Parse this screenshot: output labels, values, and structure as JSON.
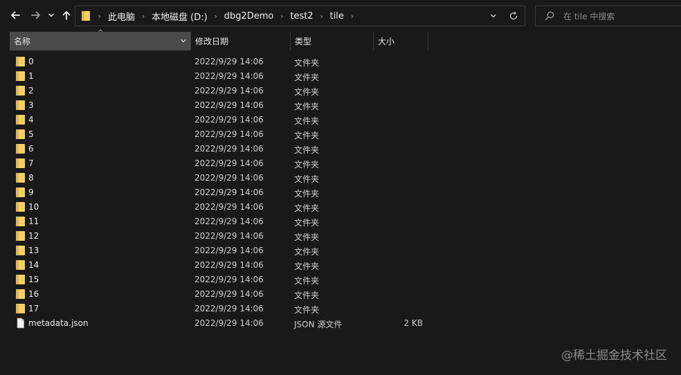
{
  "nav": {
    "back": "back-arrow",
    "forward": "forward-arrow",
    "recent": "chevron-down",
    "up": "up-arrow"
  },
  "address": {
    "crumbs": [
      "此电脑",
      "本地磁盘 (D:)",
      "dbg2Demo",
      "test2",
      "tile"
    ]
  },
  "search": {
    "placeholder": "在 tile 中搜索"
  },
  "columns": {
    "name": "名称",
    "date": "修改日期",
    "type": "类型",
    "size": "大小"
  },
  "files": [
    {
      "name": "0",
      "date": "2022/9/29 14:06",
      "type": "文件夹",
      "size": "",
      "kind": "folder"
    },
    {
      "name": "1",
      "date": "2022/9/29 14:06",
      "type": "文件夹",
      "size": "",
      "kind": "folder"
    },
    {
      "name": "2",
      "date": "2022/9/29 14:06",
      "type": "文件夹",
      "size": "",
      "kind": "folder"
    },
    {
      "name": "3",
      "date": "2022/9/29 14:06",
      "type": "文件夹",
      "size": "",
      "kind": "folder"
    },
    {
      "name": "4",
      "date": "2022/9/29 14:06",
      "type": "文件夹",
      "size": "",
      "kind": "folder"
    },
    {
      "name": "5",
      "date": "2022/9/29 14:06",
      "type": "文件夹",
      "size": "",
      "kind": "folder"
    },
    {
      "name": "6",
      "date": "2022/9/29 14:06",
      "type": "文件夹",
      "size": "",
      "kind": "folder"
    },
    {
      "name": "7",
      "date": "2022/9/29 14:06",
      "type": "文件夹",
      "size": "",
      "kind": "folder"
    },
    {
      "name": "8",
      "date": "2022/9/29 14:06",
      "type": "文件夹",
      "size": "",
      "kind": "folder"
    },
    {
      "name": "9",
      "date": "2022/9/29 14:06",
      "type": "文件夹",
      "size": "",
      "kind": "folder"
    },
    {
      "name": "10",
      "date": "2022/9/29 14:06",
      "type": "文件夹",
      "size": "",
      "kind": "folder"
    },
    {
      "name": "11",
      "date": "2022/9/29 14:06",
      "type": "文件夹",
      "size": "",
      "kind": "folder"
    },
    {
      "name": "12",
      "date": "2022/9/29 14:06",
      "type": "文件夹",
      "size": "",
      "kind": "folder"
    },
    {
      "name": "13",
      "date": "2022/9/29 14:06",
      "type": "文件夹",
      "size": "",
      "kind": "folder"
    },
    {
      "name": "14",
      "date": "2022/9/29 14:06",
      "type": "文件夹",
      "size": "",
      "kind": "folder"
    },
    {
      "name": "15",
      "date": "2022/9/29 14:06",
      "type": "文件夹",
      "size": "",
      "kind": "folder"
    },
    {
      "name": "16",
      "date": "2022/9/29 14:06",
      "type": "文件夹",
      "size": "",
      "kind": "folder"
    },
    {
      "name": "17",
      "date": "2022/9/29 14:06",
      "type": "文件夹",
      "size": "",
      "kind": "folder"
    },
    {
      "name": "metadata.json",
      "date": "2022/9/29 14:06",
      "type": "JSON 源文件",
      "size": "2 KB",
      "kind": "file"
    }
  ],
  "watermark": "@稀土掘金技术社区",
  "colors": {
    "background": "#191919",
    "folder": "#f3cf67",
    "header_active": "#4a4a4a",
    "border": "#3b3b3b"
  }
}
